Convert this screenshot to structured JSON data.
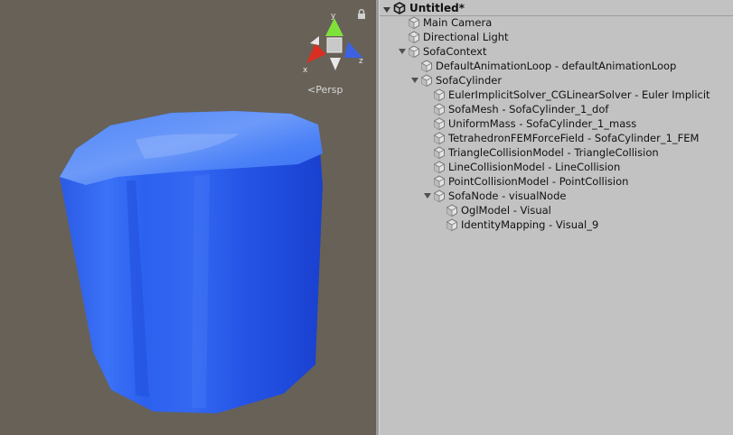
{
  "scene_view": {
    "projection_label": "Persp",
    "axis_labels": {
      "y": "y",
      "x": "x",
      "z": "z"
    },
    "background_color": "#676158",
    "object_color": "#2a62ef"
  },
  "hierarchy": {
    "scene_title": "Untitled*",
    "items": [
      {
        "label": "Main Camera",
        "depth": 1,
        "expanded": null
      },
      {
        "label": "Directional Light",
        "depth": 1,
        "expanded": null
      },
      {
        "label": "SofaContext",
        "depth": 1,
        "expanded": true
      },
      {
        "label": "DefaultAnimationLoop  -  defaultAnimationLoop",
        "depth": 2,
        "expanded": null
      },
      {
        "label": "SofaCylinder",
        "depth": 2,
        "expanded": true
      },
      {
        "label": "EulerImplicitSolver_CGLinearSolver  -  Euler Implicit",
        "depth": 3,
        "expanded": null
      },
      {
        "label": "SofaMesh  -  SofaCylinder_1_dof",
        "depth": 3,
        "expanded": null
      },
      {
        "label": "UniformMass  -  SofaCylinder_1_mass",
        "depth": 3,
        "expanded": null
      },
      {
        "label": "TetrahedronFEMForceField  -  SofaCylinder_1_FEM",
        "depth": 3,
        "expanded": null
      },
      {
        "label": "TriangleCollisionModel  -  TriangleCollision",
        "depth": 3,
        "expanded": null
      },
      {
        "label": "LineCollisionModel  -  LineCollision",
        "depth": 3,
        "expanded": null
      },
      {
        "label": "PointCollisionModel  -  PointCollision",
        "depth": 3,
        "expanded": null
      },
      {
        "label": "SofaNode - visualNode",
        "depth": 3,
        "expanded": true
      },
      {
        "label": "OglModel  -  Visual",
        "depth": 4,
        "expanded": null
      },
      {
        "label": "IdentityMapping  -  Visual_9",
        "depth": 4,
        "expanded": null
      }
    ]
  }
}
